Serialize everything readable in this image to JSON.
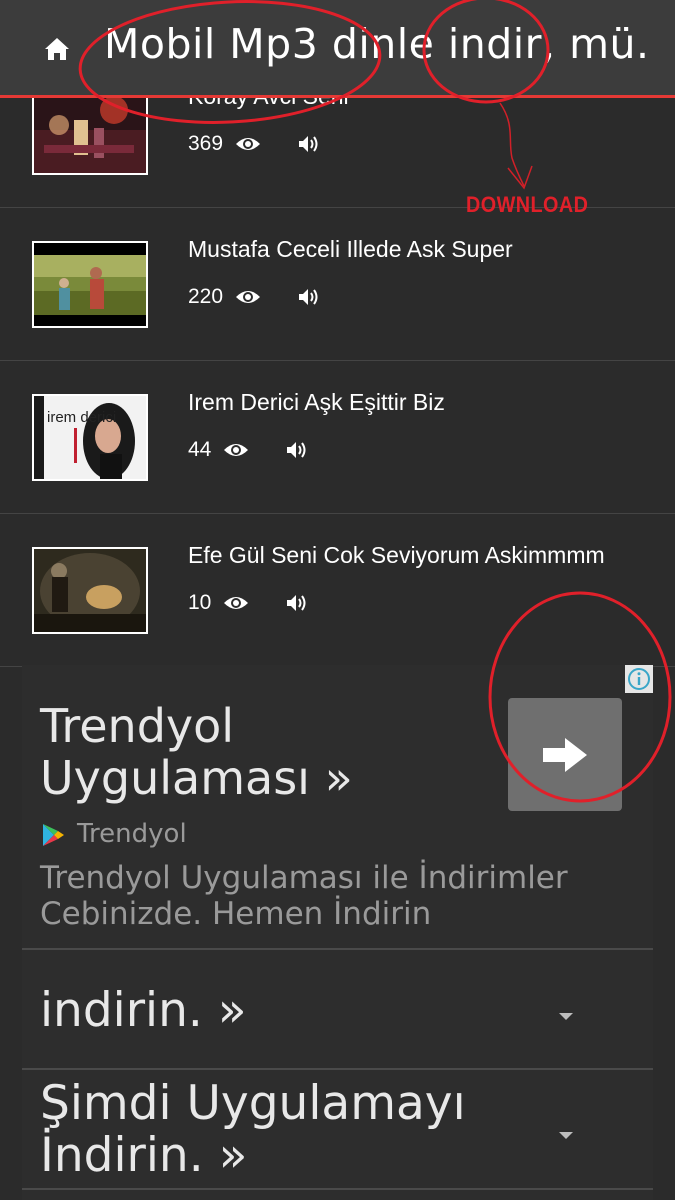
{
  "header": {
    "title": "Mobil Mp3 dinle indir, mü.",
    "home_icon": "home-icon"
  },
  "songs": [
    {
      "title": "Koray Avci Seni",
      "views": "369"
    },
    {
      "title": "Mustafa Ceceli Illede Ask Super",
      "views": "220"
    },
    {
      "title": "Irem Derici Aşk Eşittir Biz",
      "views": "44",
      "thumb_text": "irem derici"
    },
    {
      "title": "Efe Gül Seni Cok Seviyorum Askimmmm",
      "views": "10"
    }
  ],
  "annotation": {
    "label": "DOWNLOAD",
    "color": "#e0202a"
  },
  "ad": {
    "headline": "Trendyol Uygulaması »",
    "advertiser": "Trendyol",
    "description": "Trendyol Uygulaması ile İndirimler Cebinizde. Hemen İndirin",
    "option1": "indirin. »",
    "option2": "Şimdi Uygulamayı İndirin. »"
  },
  "colors": {
    "header_bg": "#3c3c3c",
    "accent": "#e53935",
    "body_bg": "#2b2b2b"
  }
}
